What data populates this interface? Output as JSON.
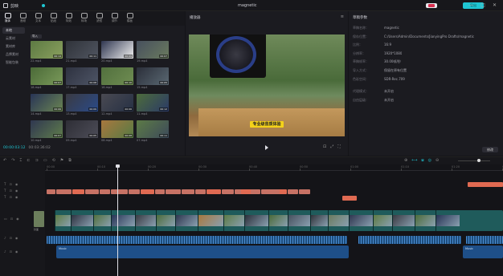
{
  "app": {
    "name": "剪映",
    "project": "magnetic"
  },
  "window": {
    "controls": [
      "—",
      "□",
      "✕"
    ]
  },
  "header": {
    "export_label": "导出"
  },
  "toolbar": {
    "tools": [
      {
        "label": "媒体",
        "icon": "media-icon",
        "active": true
      },
      {
        "label": "音频",
        "icon": "audio-icon"
      },
      {
        "label": "文本",
        "icon": "text-icon"
      },
      {
        "label": "贴纸",
        "icon": "sticker-icon"
      },
      {
        "label": "特效",
        "icon": "effects-icon"
      },
      {
        "label": "转场",
        "icon": "transition-icon"
      },
      {
        "label": "滤镜",
        "icon": "filter-icon"
      },
      {
        "label": "调节",
        "icon": "adjust-icon"
      },
      {
        "label": "模板",
        "icon": "template-icon"
      }
    ]
  },
  "media_sidebar": {
    "items": [
      {
        "label": "本地",
        "active": true
      },
      {
        "label": "云素材"
      },
      {
        "label": "素材库"
      },
      {
        "label": "品牌素材"
      },
      {
        "label": "智能包装"
      }
    ]
  },
  "media": {
    "import_label": "导入",
    "clips": [
      {
        "name": "22.mp4",
        "dur": "00:14",
        "colors": [
          "#5d7a43",
          "#8aa05e"
        ]
      },
      {
        "name": "21.mp4",
        "dur": "00:11",
        "colors": [
          "#30333a",
          "#505560"
        ]
      },
      {
        "name": "20.mp4",
        "dur": "00:09",
        "colors": [
          "#2f3650",
          "#f0f0f0"
        ]
      },
      {
        "name": "19.mp4",
        "dur": "00:07",
        "colors": [
          "#47505e",
          "#6a7a5e"
        ]
      },
      {
        "name": "18.mp4",
        "dur": "00:07",
        "colors": [
          "#4b6a38",
          "#7a9a5a"
        ]
      },
      {
        "name": "17.mp4",
        "dur": "00:08",
        "colors": [
          "#2e3240",
          "#4e5566"
        ]
      },
      {
        "name": "16.mp4",
        "dur": "00:10",
        "colors": [
          "#52703e",
          "#6f8d52"
        ]
      },
      {
        "name": "15.mp4",
        "dur": "00:05",
        "colors": [
          "#2b2f3a",
          "#5a6872"
        ]
      },
      {
        "name": "14.mp4",
        "dur": "00:06",
        "colors": [
          "#283456",
          "#6a8452"
        ]
      },
      {
        "name": "13.mp4",
        "dur": "00:09",
        "colors": [
          "#3a3a42",
          "#2a4a88"
        ]
      },
      {
        "name": "12.mp4",
        "dur": "00:06",
        "colors": [
          "#4a4a52",
          "#263044"
        ]
      },
      {
        "name": "11.mp4",
        "dur": "00:12",
        "colors": [
          "#4d6c3b",
          "#2b3a66"
        ]
      },
      {
        "name": "10.mp4",
        "dur": "00:07",
        "colors": [
          "#2f3750",
          "#5f7c4c"
        ]
      },
      {
        "name": "09.mp4",
        "dur": "00:05",
        "colors": [
          "#2e2e36",
          "#4d4d58"
        ]
      },
      {
        "name": "08.mp4",
        "dur": "00:08",
        "colors": [
          "#a8783e",
          "#567a44"
        ]
      },
      {
        "name": "07.mp4",
        "dur": "00:11",
        "colors": [
          "#5c7a46",
          "#3d4a5a"
        ]
      }
    ]
  },
  "player": {
    "title": "播放器",
    "subtitle_text": "专业级音质体验",
    "time_current": "00:00:03:12",
    "time_total": "00:03:36:02",
    "controls": [
      "⊡",
      "⤢",
      "⛶"
    ]
  },
  "properties": {
    "title": "草稿参数",
    "rows": [
      {
        "k": "草稿名称：",
        "v": "magnetic"
      },
      {
        "k": "保存位置：",
        "v": "C:/Users/Admin/Documents/JianyingPro Drafts/magnetic"
      },
      {
        "k": "比例：",
        "v": "16:9"
      },
      {
        "k": "分辨率：",
        "v": "1920*1080"
      },
      {
        "k": "草稿帧率：",
        "v": "30.00帧/秒"
      },
      {
        "k": "导入方式：",
        "v": "保留在原有位置"
      },
      {
        "k": "色彩空间：",
        "v": "SDR-Rec.709"
      },
      {
        "k": "代理模式：",
        "v": "未开启",
        "gap": true
      },
      {
        "k": "自由层级：",
        "v": "未开启"
      }
    ],
    "modify_label": "修改"
  },
  "timeline": {
    "tools": [
      "↶",
      "↷",
      "⌶",
      "⊏",
      "⊐",
      "▭",
      "⟲",
      "⚑",
      "⧉"
    ],
    "right_tools": [
      "⊕",
      "⟷",
      "⧈",
      "◎",
      "⊖"
    ],
    "ruler": [
      "00:00",
      "00:10",
      "00:20",
      "00:30",
      "00:40",
      "00:50",
      "01:00",
      "01:10",
      "01:20",
      "01:30"
    ],
    "track_labels": [
      "T",
      "T",
      "T",
      "▭",
      "♪",
      "♪"
    ],
    "cover_label": "封面",
    "music_label": "Music"
  }
}
